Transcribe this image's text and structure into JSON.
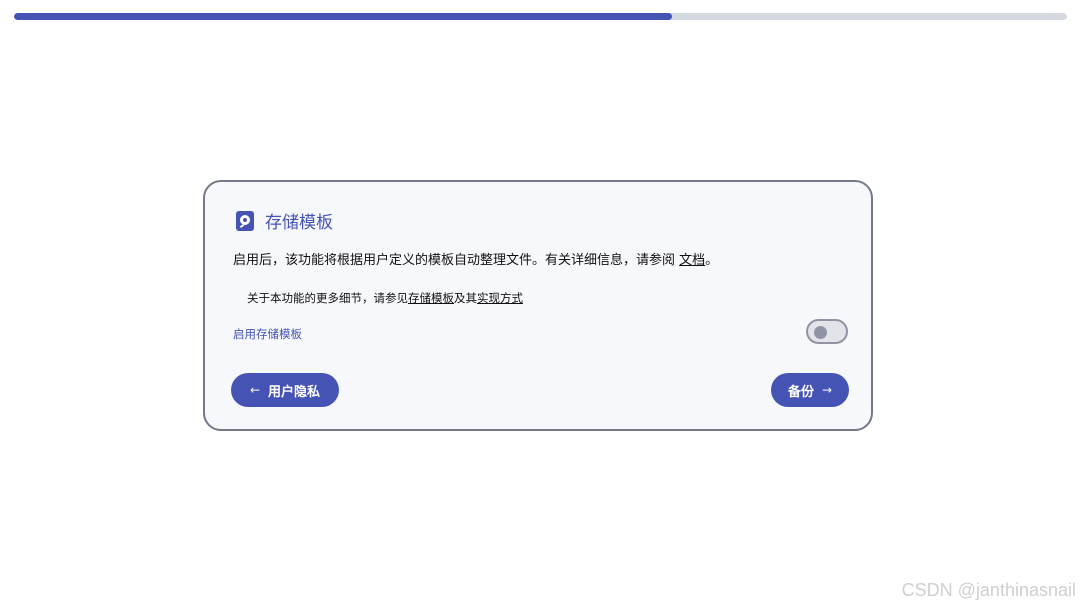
{
  "progress": {
    "fraction": 0.625,
    "color": "#4553b5",
    "track_color": "#d6d9e2"
  },
  "card": {
    "title": "存储模板",
    "title_icon": "storage-template-icon",
    "description": {
      "text": "启用后，该功能将根据用户定义的模板自动整理文件。有关详细信息，请参阅 ",
      "link": "文档",
      "suffix": "。"
    },
    "detail": {
      "prefix": "关于本功能的更多细节，请参见",
      "link1": "存储模板",
      "middle": "及其",
      "link2": "实现方式"
    },
    "toggle": {
      "label": "启用存储模板",
      "enabled": false
    },
    "buttons": {
      "back": {
        "label": "用户隐私",
        "icon": "arrow-left-icon"
      },
      "next": {
        "label": "备份",
        "icon": "arrow-right-icon"
      }
    }
  },
  "watermark": "CSDN @janthinasnail",
  "colors": {
    "accent": "#4553b5",
    "card_border": "#757889",
    "card_background": "#f7f8fb"
  }
}
